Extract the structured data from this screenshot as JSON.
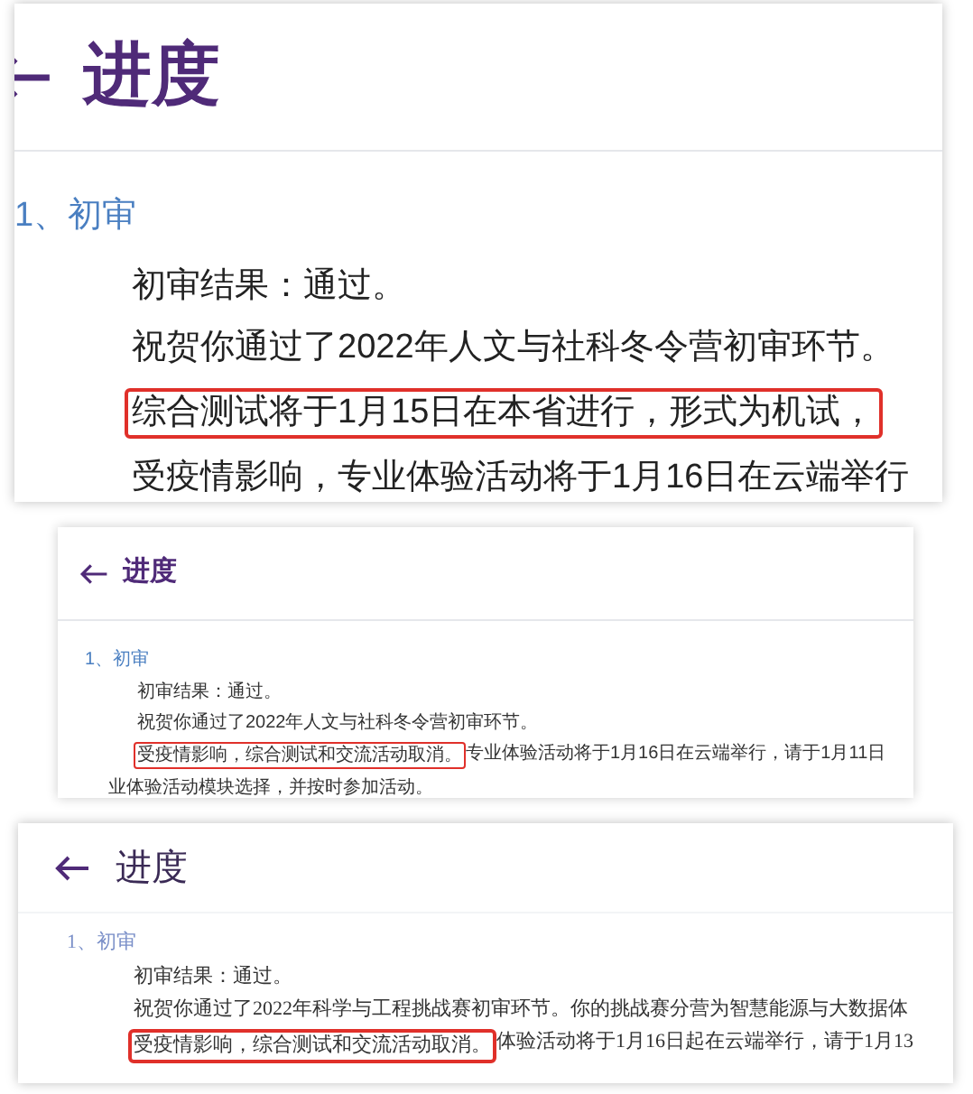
{
  "panels": [
    {
      "kind": "large",
      "title": "进度",
      "section": "1、初审",
      "lines": [
        {
          "kind": "paragraph",
          "segments": [
            {
              "text": "初审结果：通过。",
              "boxed": false
            }
          ]
        },
        {
          "kind": "paragraph",
          "segments": [
            {
              "text": "祝贺你通过了2022年人文与社科冬令营初审环节。",
              "boxed": false
            }
          ]
        },
        {
          "kind": "paragraph",
          "segments": [
            {
              "text": "综合测试将于1月15日在本省进行，形式为机试，",
              "boxed": true
            }
          ]
        },
        {
          "kind": "paragraph",
          "segments": [
            {
              "text": "受疫情影响，专业体验活动将于1月16日在云端举行",
              "boxed": false
            }
          ]
        }
      ]
    },
    {
      "kind": "compact",
      "title": "进度",
      "section": "1、初审",
      "lines": [
        {
          "kind": "paragraph",
          "segments": [
            {
              "text": "初审结果：通过。",
              "boxed": false
            }
          ]
        },
        {
          "kind": "paragraph",
          "segments": [
            {
              "text": "祝贺你通过了2022年人文与社科冬令营初审环节。",
              "boxed": false
            }
          ]
        },
        {
          "kind": "paragraph",
          "segments": [
            {
              "text": "受疫情影响，综合测试和交流活动取消。",
              "boxed": true
            },
            {
              "text": "专业体验活动将于1月16日在云端举行，请于1月11日",
              "boxed": false
            }
          ]
        },
        {
          "kind": "continuation",
          "segments": [
            {
              "text": "业体验活动模块选择，并按时参加活动。",
              "boxed": false
            }
          ]
        }
      ]
    },
    {
      "kind": "print",
      "title": "进度",
      "section": "1、初审",
      "lines": [
        {
          "kind": "paragraph",
          "segments": [
            {
              "text": "初审结果：通过。",
              "boxed": false
            }
          ]
        },
        {
          "kind": "paragraph",
          "segments": [
            {
              "text": "祝贺你通过了2022年科学与工程挑战赛初审环节。你的挑战赛分营为智慧能源与大数据体",
              "boxed": false
            }
          ]
        },
        {
          "kind": "paragraph",
          "segments": [
            {
              "text": "受疫情影响，综合测试和交流活动取消。",
              "boxed": true
            },
            {
              "text": "体验活动将于1月16日起在云端举行，请于1月13",
              "boxed": false
            }
          ]
        }
      ]
    }
  ]
}
